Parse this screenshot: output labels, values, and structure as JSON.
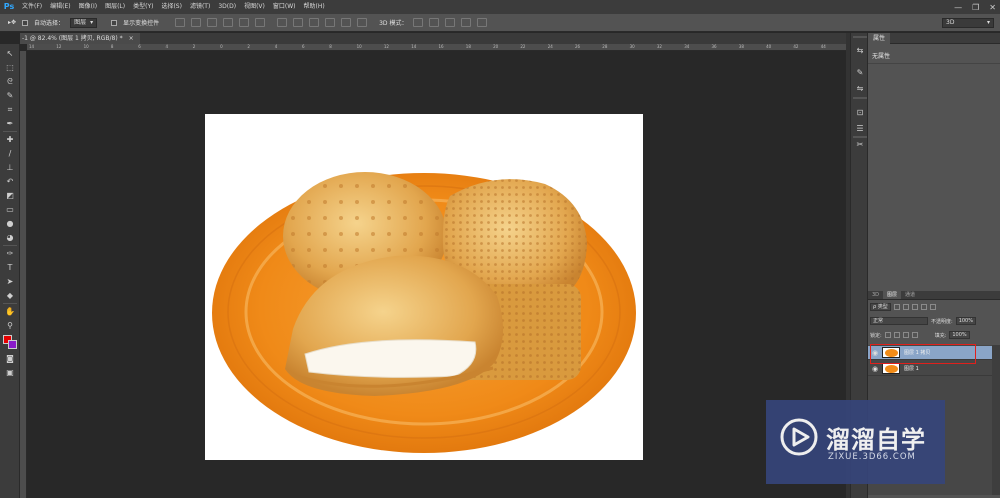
{
  "app": {
    "logo": "Ps"
  },
  "menu": [
    "文件(F)",
    "编辑(E)",
    "图像(I)",
    "图层(L)",
    "类型(Y)",
    "选择(S)",
    "滤镜(T)",
    "3D(D)",
    "视图(V)",
    "窗口(W)",
    "帮助(H)"
  ],
  "window_controls": {
    "minimize": "—",
    "restore": "❐",
    "close": "✕"
  },
  "options_bar": {
    "auto_select_label": "自动选择：",
    "auto_select_target": "图层",
    "show_transform_label": "显示变换控件",
    "mode_3d_label": "3D 模式：",
    "workspace": "3D"
  },
  "document_tab": {
    "title": "-1 @ 82.4% (图层 1 拷贝, RGB/8) *",
    "close": "×"
  },
  "ruler": {
    "top_labels": [
      "14",
      "12",
      "10",
      "8",
      "6",
      "4",
      "2",
      "0",
      "2",
      "4",
      "6",
      "8",
      "10",
      "12",
      "14",
      "16",
      "18",
      "20",
      "22",
      "24",
      "26",
      "28",
      "30",
      "32",
      "34",
      "36",
      "38",
      "40",
      "42",
      "44"
    ]
  },
  "properties_panel": {
    "tab": "属性",
    "content": "无属性"
  },
  "layers_panel": {
    "tabs": [
      "3D",
      "图层",
      "通道"
    ],
    "filter_label": "ρ 类型",
    "blend_mode": "正常",
    "opacity_label": "不透明度:",
    "opacity_value": "100%",
    "lock_label": "锁定:",
    "fill_label": "填充:",
    "fill_value": "100%",
    "layers": [
      {
        "name": "图层 1 拷贝",
        "selected": true,
        "visible": true
      },
      {
        "name": "图层 1",
        "selected": false,
        "visible": true
      }
    ]
  },
  "watermark": {
    "title": "溜溜自学",
    "url": "ZIXUE.3D66.COM",
    "accent": "#36457a"
  },
  "colors": {
    "foreground": "#e60000",
    "background": "#8a1bc8",
    "plate": "#f28c18"
  }
}
